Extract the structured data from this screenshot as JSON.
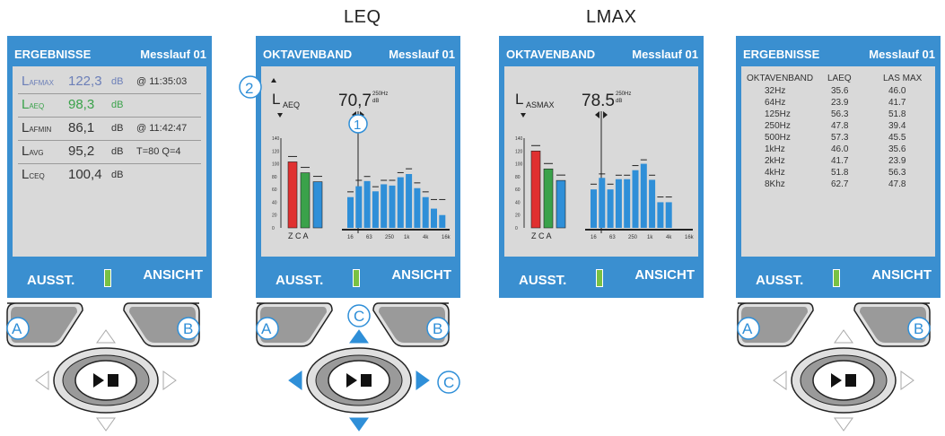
{
  "headings": {
    "leq": "LEQ",
    "lmax": "LMAX"
  },
  "screen1": {
    "title": "ERGEBNISSE",
    "run": "Messlauf 01",
    "rows": [
      {
        "label": "L",
        "sub": "AFMAX",
        "value": "122,3",
        "unit": "dB",
        "extra": "@ 11:35:03",
        "color": "#6c7fb8"
      },
      {
        "label": "L",
        "sub": "AEQ",
        "value": "98,3",
        "unit": "dB",
        "extra": "",
        "color": "#3aa24a"
      },
      {
        "label": "L",
        "sub": "AFMIN",
        "value": "86,1",
        "unit": "dB",
        "extra": "@ 11:42:47",
        "color": "#333333"
      },
      {
        "label": "L",
        "sub": "AVG",
        "value": "95,2",
        "unit": "dB",
        "extra": "T=80  Q=4",
        "color": "#333333"
      },
      {
        "label": "L",
        "sub": "CEQ",
        "value": "100,4",
        "unit": "dB",
        "extra": "",
        "color": "#333333"
      }
    ],
    "footer_left": "AUSST.",
    "footer_right": "ANSICHT"
  },
  "screen2": {
    "title": "OKTAVENBAND",
    "run": "Messlauf 01",
    "param": "L",
    "param_sub": "AEQ",
    "reading": "70,7",
    "reading_unit_top": "250Hz",
    "reading_unit_bottom": "dB",
    "callout1": "1",
    "callout2": "2",
    "y_ticks": [
      "140",
      "120",
      "100",
      "80",
      "60",
      "40",
      "20",
      "0"
    ],
    "weights_label": "Z C A",
    "x_ticks": [
      "16",
      "63",
      "250",
      "1k",
      "4k",
      "16k"
    ],
    "footer_left": "AUSST.",
    "footer_right": "ANSICHT"
  },
  "screen3": {
    "title": "OKTAVENBAND",
    "run": "Messlauf 01",
    "param": "L",
    "param_sub": "ASMAX",
    "reading": "78.5",
    "reading_unit_top": "250Hz",
    "reading_unit_bottom": "dB",
    "y_ticks": [
      "140",
      "120",
      "100",
      "80",
      "60",
      "40",
      "20",
      "0"
    ],
    "weights_label": "Z C A",
    "x_ticks": [
      "16",
      "63",
      "250",
      "1k",
      "4k",
      "16k"
    ],
    "footer_left": "AUSST.",
    "footer_right": "ANSICHT"
  },
  "screen4": {
    "title": "ERGEBNISSE",
    "run": "Messlauf 01",
    "col_band": "OKTAVENBAND",
    "col_a": "LAEQ",
    "col_b": "LAS MAX",
    "rows": [
      {
        "band": "32Hz",
        "a": "35.6",
        "b": "46.0"
      },
      {
        "band": "64Hz",
        "a": "23.9",
        "b": "41.7"
      },
      {
        "band": "125Hz",
        "a": "56.3",
        "b": "51.8"
      },
      {
        "band": "250Hz",
        "a": "47.8",
        "b": "39.4"
      },
      {
        "band": "500Hz",
        "a": "57.3",
        "b": "45.5"
      },
      {
        "band": "1kHz",
        "a": "46.0",
        "b": "35.6"
      },
      {
        "band": "2kHz",
        "a": "41.7",
        "b": "23.9"
      },
      {
        "band": "4kHz",
        "a": "51.8",
        "b": "56.3"
      },
      {
        "band": "8Khz",
        "a": "62.7",
        "b": "47.8"
      }
    ],
    "footer_left": "AUSST.",
    "footer_right": "ANSICHT"
  },
  "buttons": {
    "a": "A",
    "b": "B",
    "c": "C"
  },
  "chart_data": [
    {
      "type": "bar",
      "title": "LAEQ",
      "ylim": [
        0,
        140
      ],
      "weights": [
        {
          "name": "Z",
          "value": 103,
          "color": "#e03030"
        },
        {
          "name": "C",
          "value": 86,
          "color": "#3aa24a"
        },
        {
          "name": "A",
          "value": 72,
          "color": "#2f8fd8"
        }
      ],
      "bands": [
        48,
        65,
        73,
        57,
        68,
        66,
        79,
        84,
        62,
        48,
        30,
        20
      ],
      "peaks": [
        52,
        70,
        76,
        60,
        70,
        70,
        82,
        88,
        66,
        52,
        40,
        40
      ]
    },
    {
      "type": "bar",
      "title": "LASMAX",
      "ylim": [
        0,
        140
      ],
      "weights": [
        {
          "name": "Z",
          "value": 120,
          "color": "#e03030"
        },
        {
          "name": "C",
          "value": 92,
          "color": "#3aa24a"
        },
        {
          "name": "A",
          "value": 74,
          "color": "#2f8fd8"
        }
      ],
      "bands": [
        60,
        78,
        60,
        76,
        76,
        90,
        100,
        75,
        40,
        40
      ],
      "peaks": [
        64,
        80,
        64,
        78,
        78,
        93,
        102,
        78,
        44,
        44
      ]
    }
  ]
}
